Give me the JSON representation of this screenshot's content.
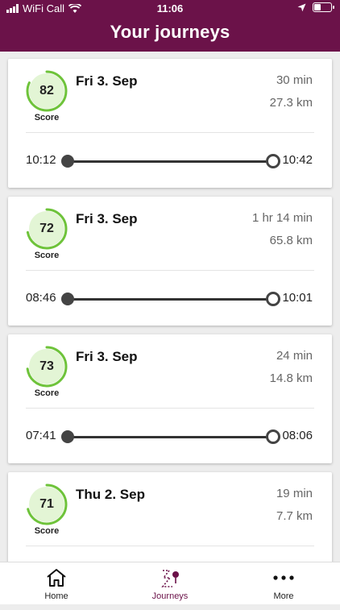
{
  "status_bar": {
    "carrier": "WiFi Call",
    "time": "11:06"
  },
  "header": {
    "title": "Your journeys"
  },
  "score_label": "Score",
  "journeys": [
    {
      "score": "82",
      "date": "Fri 3. Sep",
      "duration": "30 min",
      "distance": "27.3 km",
      "start": "10:12",
      "end": "10:42"
    },
    {
      "score": "72",
      "date": "Fri 3. Sep",
      "duration": "1 hr 14 min",
      "distance": "65.8 km",
      "start": "08:46",
      "end": "10:01"
    },
    {
      "score": "73",
      "date": "Fri 3. Sep",
      "duration": "24 min",
      "distance": "14.8 km",
      "start": "07:41",
      "end": "08:06"
    },
    {
      "score": "71",
      "date": "Thu 2. Sep",
      "duration": "19 min",
      "distance": "7.7 km",
      "start": "",
      "end": ""
    }
  ],
  "tabs": [
    {
      "label": "Home",
      "icon": "home-icon"
    },
    {
      "label": "Journeys",
      "icon": "journeys-route-icon"
    },
    {
      "label": "More",
      "icon": "more-dots-icon"
    }
  ],
  "colors": {
    "brand": "#6b1249",
    "score_green": "#6ec33a",
    "score_fill": "#e3f5d5"
  }
}
